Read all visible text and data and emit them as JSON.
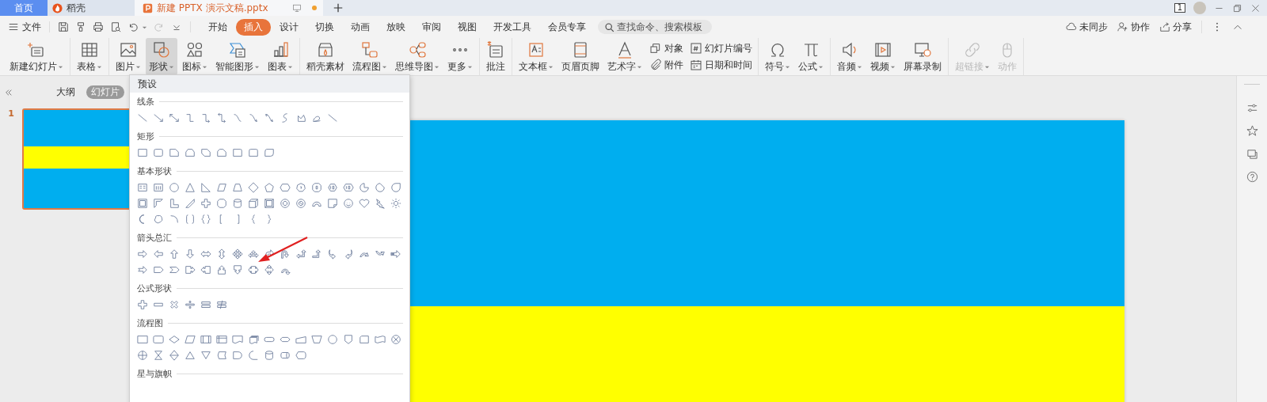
{
  "tab_bar": {
    "tabs": [
      {
        "label": "首页",
        "kind": "home",
        "selected": false
      },
      {
        "label": "稻壳",
        "kind": "docer",
        "selected": false
      },
      {
        "label": "新建 PPTX 演示文稿.pptx",
        "kind": "document",
        "selected": true,
        "unsaved": true
      }
    ],
    "window_badge": "1"
  },
  "menu": {
    "file": "文件",
    "tabs": [
      {
        "label": "开始",
        "selected": false
      },
      {
        "label": "插入",
        "selected": true
      },
      {
        "label": "设计",
        "selected": false
      },
      {
        "label": "切换",
        "selected": false
      },
      {
        "label": "动画",
        "selected": false
      },
      {
        "label": "放映",
        "selected": false
      },
      {
        "label": "审阅",
        "selected": false
      },
      {
        "label": "视图",
        "selected": false
      },
      {
        "label": "开发工具",
        "selected": false
      },
      {
        "label": "会员专享",
        "selected": false
      }
    ],
    "search": {
      "placeholder": "查找命令、搜索模板"
    },
    "actions": [
      {
        "label": "未同步"
      },
      {
        "label": "协作"
      },
      {
        "label": "分享"
      }
    ]
  },
  "ribbon": [
    {
      "items": [
        {
          "kind": "large",
          "label": "新建幻灯片",
          "dropdown": true,
          "pressed": false,
          "disabled": false
        }
      ]
    },
    {
      "items": [
        {
          "kind": "large",
          "label": "表格",
          "dropdown": true,
          "pressed": false,
          "disabled": false
        }
      ]
    },
    {
      "items": [
        {
          "kind": "large",
          "label": "图片",
          "dropdown": true,
          "pressed": false,
          "disabled": false
        },
        {
          "kind": "large",
          "label": "形状",
          "dropdown": true,
          "pressed": true,
          "disabled": false
        },
        {
          "kind": "large",
          "label": "图标",
          "dropdown": true,
          "pressed": false,
          "disabled": false
        },
        {
          "kind": "large",
          "label": "智能图形",
          "dropdown": true,
          "pressed": false,
          "disabled": false
        },
        {
          "kind": "large",
          "label": "图表",
          "dropdown": true,
          "pressed": false,
          "disabled": false
        }
      ]
    },
    {
      "items": [
        {
          "kind": "large",
          "label": "稻壳素材",
          "dropdown": false,
          "pressed": false,
          "disabled": false
        },
        {
          "kind": "large",
          "label": "流程图",
          "dropdown": true,
          "pressed": false,
          "disabled": false
        },
        {
          "kind": "large",
          "label": "思维导图",
          "dropdown": true,
          "pressed": false,
          "disabled": false
        },
        {
          "kind": "large",
          "label": "更多",
          "dropdown": true,
          "pressed": false,
          "disabled": false
        }
      ]
    },
    {
      "items": [
        {
          "kind": "large",
          "label": "批注",
          "dropdown": false,
          "pressed": false,
          "disabled": false
        }
      ]
    },
    {
      "items": [
        {
          "kind": "large",
          "label": "文本框",
          "dropdown": true,
          "pressed": false,
          "disabled": false
        },
        {
          "kind": "large",
          "label": "页眉页脚",
          "dropdown": false,
          "pressed": false,
          "disabled": false
        },
        {
          "kind": "large",
          "label": "艺术字",
          "dropdown": true,
          "pressed": false,
          "disabled": false
        },
        {
          "kind": "small",
          "label": "对象",
          "pressed": false,
          "disabled": false
        },
        {
          "kind": "small",
          "label": "附件",
          "pressed": false,
          "disabled": false
        },
        {
          "kind": "small",
          "label": "幻灯片编号",
          "pressed": false,
          "disabled": false
        },
        {
          "kind": "small",
          "label": "日期和时间",
          "pressed": false,
          "disabled": false
        }
      ]
    },
    {
      "items": [
        {
          "kind": "large",
          "label": "符号",
          "dropdown": true,
          "pressed": false,
          "disabled": false
        },
        {
          "kind": "large",
          "label": "公式",
          "dropdown": true,
          "pressed": false,
          "disabled": false
        }
      ]
    },
    {
      "items": [
        {
          "kind": "large",
          "label": "音频",
          "dropdown": true,
          "pressed": false,
          "disabled": false
        },
        {
          "kind": "large",
          "label": "视频",
          "dropdown": true,
          "pressed": false,
          "disabled": false
        },
        {
          "kind": "large",
          "label": "屏幕录制",
          "dropdown": false,
          "pressed": false,
          "disabled": false
        }
      ]
    },
    {
      "items": [
        {
          "kind": "large",
          "label": "超链接",
          "dropdown": true,
          "pressed": false,
          "disabled": true
        },
        {
          "kind": "large",
          "label": "动作",
          "dropdown": false,
          "pressed": false,
          "disabled": true
        }
      ]
    }
  ],
  "panel": {
    "tabs": [
      {
        "label": "大纲",
        "selected": false
      },
      {
        "label": "幻灯片",
        "selected": true
      }
    ],
    "slides": [
      {
        "number": "1",
        "selected": true
      }
    ]
  },
  "shape_menu": {
    "header": "预设",
    "sections": [
      {
        "title": "线条"
      },
      {
        "title": "矩形"
      },
      {
        "title": "基本形状"
      },
      {
        "title": "箭头总汇"
      },
      {
        "title": "公式形状"
      },
      {
        "title": "流程图"
      },
      {
        "title": "星与旗帜"
      }
    ]
  }
}
